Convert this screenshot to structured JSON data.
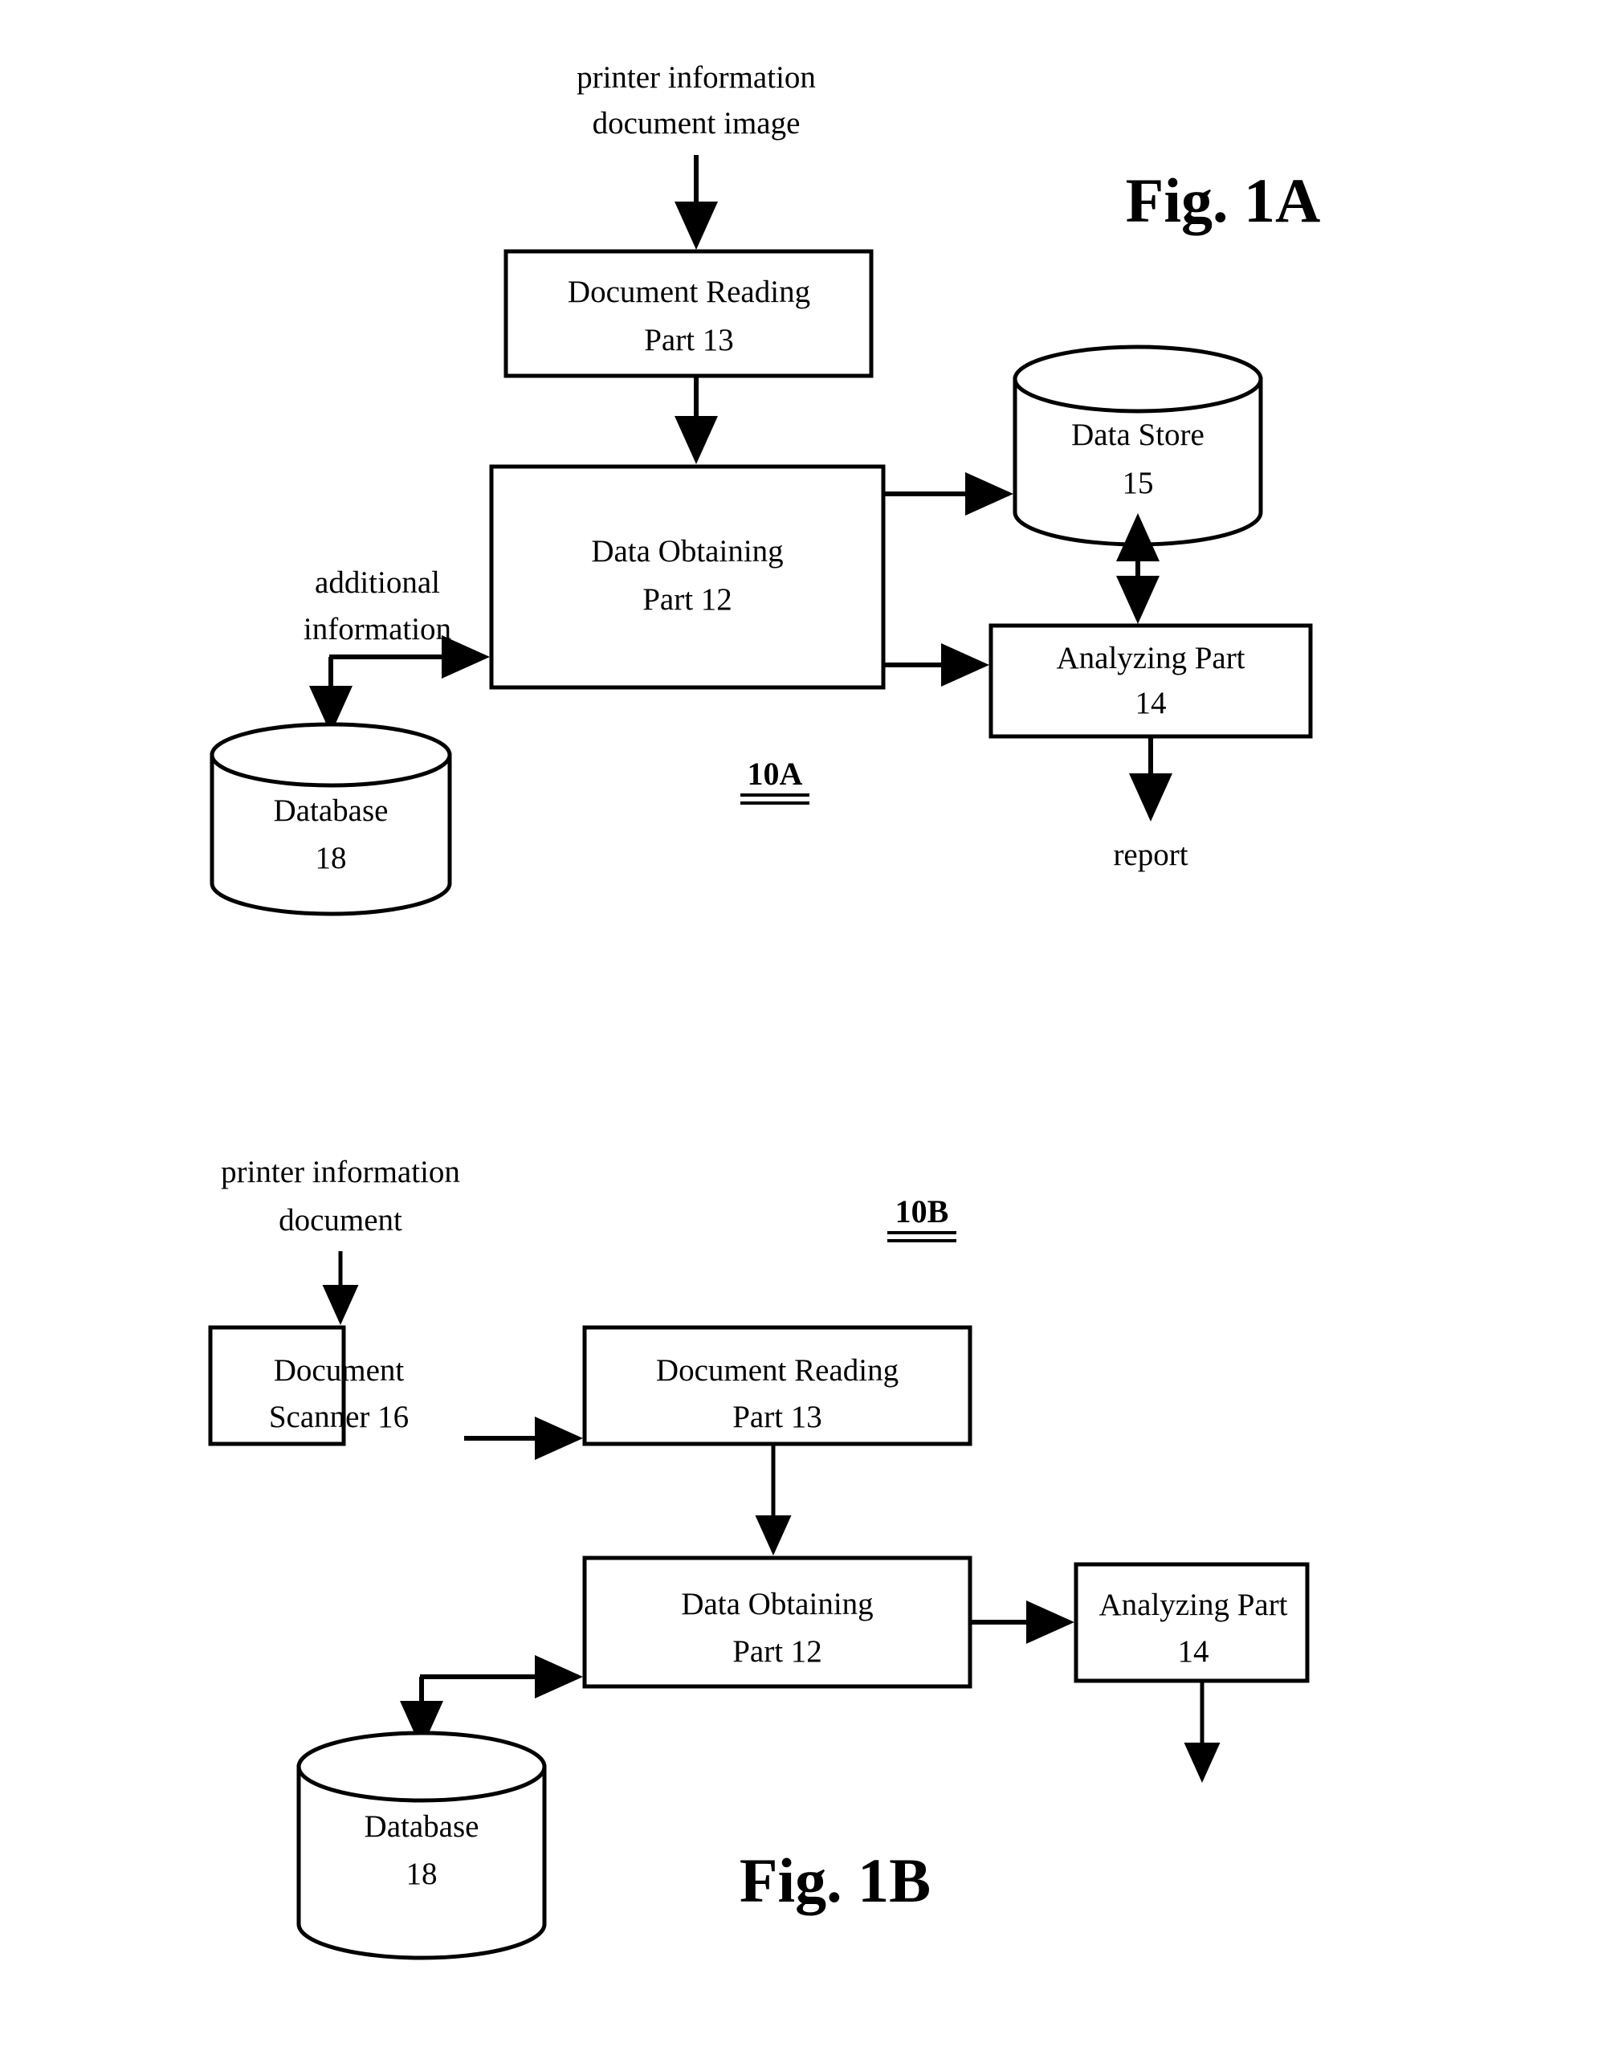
{
  "sheet": {
    "background_color": "#ffffff",
    "ink_color": "#000000"
  },
  "figures": [
    {
      "id": "fig-1a",
      "title": "Fig. 1A",
      "system_ref": "10A",
      "input_label_line1": "printer information",
      "input_label_line2": "document image",
      "side_input_line1": "additional",
      "side_input_line2": "information",
      "output_label": "report",
      "nodes": [
        {
          "key": "doc_reading",
          "line1": "Document Reading",
          "line2": "Part 13",
          "shape": "box"
        },
        {
          "key": "data_obtaining",
          "line1": "Data Obtaining",
          "line2": "Part 12",
          "shape": "box"
        },
        {
          "key": "data_store",
          "line1": "Data Store",
          "line2": "15",
          "shape": "cylinder"
        },
        {
          "key": "analyzing",
          "line1": "Analyzing Part",
          "line2": "14",
          "shape": "box"
        },
        {
          "key": "database",
          "line1": "Database",
          "line2": "18",
          "shape": "cylinder"
        }
      ]
    },
    {
      "id": "fig-1b",
      "title": "Fig. 1B",
      "system_ref": "10B",
      "input_label_line1": "printer information",
      "input_label_line2": "document",
      "nodes": [
        {
          "key": "doc_scanner",
          "line1": "Document",
          "line2": "Scanner 16",
          "shape": "box"
        },
        {
          "key": "doc_reading",
          "line1": "Document Reading",
          "line2": "Part 13",
          "shape": "box"
        },
        {
          "key": "data_obtaining",
          "line1": "Data Obtaining",
          "line2": "Part 12",
          "shape": "box"
        },
        {
          "key": "analyzing",
          "line1": "Analyzing Part",
          "line2": "14",
          "shape": "box"
        },
        {
          "key": "database",
          "line1": "Database",
          "line2": "18",
          "shape": "cylinder"
        }
      ]
    }
  ],
  "fig1a": {
    "title": "Fig. 1A",
    "ref": "10A",
    "input_l1": "printer information",
    "input_l2": "document image",
    "side_l1": "additional",
    "side_l2": "information",
    "output": "report",
    "doc_reading_l1": "Document Reading",
    "doc_reading_l2": "Part 13",
    "data_obtaining_l1": "Data Obtaining",
    "data_obtaining_l2": "Part 12",
    "data_store_l1": "Data Store",
    "data_store_l2": "15",
    "analyzing_l1": "Analyzing Part",
    "analyzing_l2": "14",
    "database_l1": "Database",
    "database_l2": "18"
  },
  "fig1b": {
    "title": "Fig. 1B",
    "ref": "10B",
    "input_l1": "printer information",
    "input_l2": "document",
    "doc_scanner_l1": "Document",
    "doc_scanner_l2": "Scanner 16",
    "doc_reading_l1": "Document Reading",
    "doc_reading_l2": "Part 13",
    "data_obtaining_l1": "Data Obtaining",
    "data_obtaining_l2": "Part 12",
    "analyzing_l1": "Analyzing Part",
    "analyzing_l2": "14",
    "database_l1": "Database",
    "database_l2": "18"
  }
}
